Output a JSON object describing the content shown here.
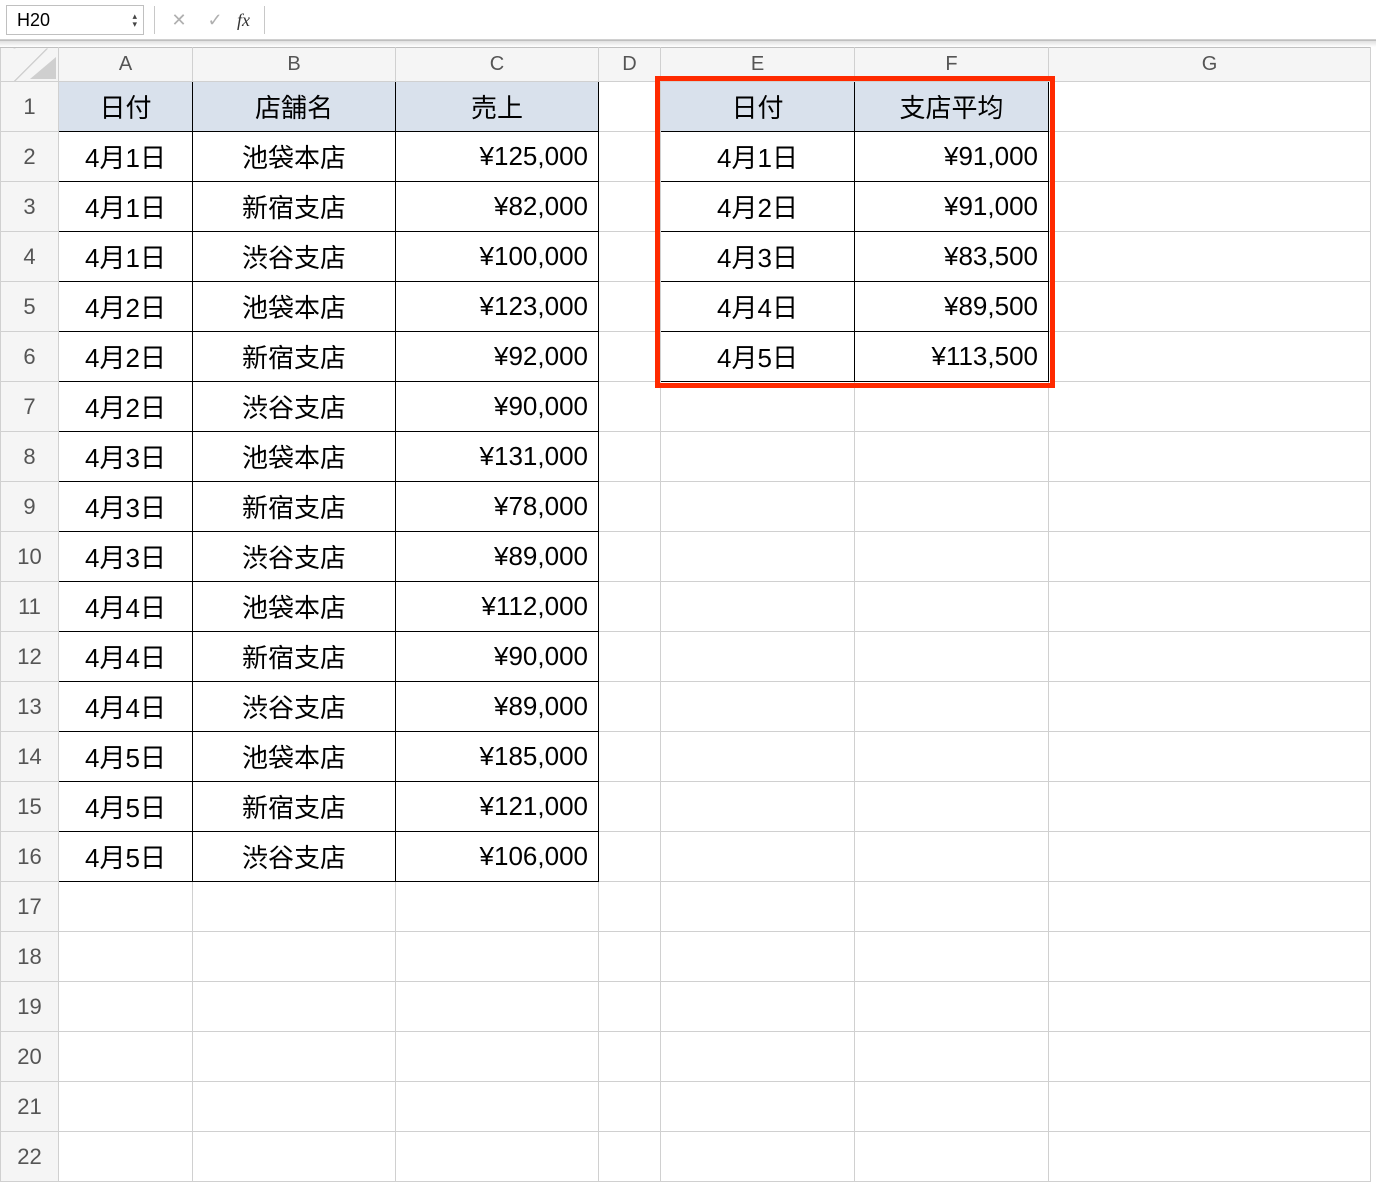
{
  "nameBox": "H20",
  "fx_label": "fx",
  "formula": "",
  "columns": [
    "A",
    "B",
    "C",
    "D",
    "E",
    "F",
    "G"
  ],
  "rowCount": 22,
  "table1": {
    "headers": {
      "A": "日付",
      "B": "店舗名",
      "C": "売上"
    },
    "rows": [
      {
        "date": "4月1日",
        "store": "池袋本店",
        "sales": "¥125,000"
      },
      {
        "date": "4月1日",
        "store": "新宿支店",
        "sales": "¥82,000"
      },
      {
        "date": "4月1日",
        "store": "渋谷支店",
        "sales": "¥100,000"
      },
      {
        "date": "4月2日",
        "store": "池袋本店",
        "sales": "¥123,000"
      },
      {
        "date": "4月2日",
        "store": "新宿支店",
        "sales": "¥92,000"
      },
      {
        "date": "4月2日",
        "store": "渋谷支店",
        "sales": "¥90,000"
      },
      {
        "date": "4月3日",
        "store": "池袋本店",
        "sales": "¥131,000"
      },
      {
        "date": "4月3日",
        "store": "新宿支店",
        "sales": "¥78,000"
      },
      {
        "date": "4月3日",
        "store": "渋谷支店",
        "sales": "¥89,000"
      },
      {
        "date": "4月4日",
        "store": "池袋本店",
        "sales": "¥112,000"
      },
      {
        "date": "4月4日",
        "store": "新宿支店",
        "sales": "¥90,000"
      },
      {
        "date": "4月4日",
        "store": "渋谷支店",
        "sales": "¥89,000"
      },
      {
        "date": "4月5日",
        "store": "池袋本店",
        "sales": "¥185,000"
      },
      {
        "date": "4月5日",
        "store": "新宿支店",
        "sales": "¥121,000"
      },
      {
        "date": "4月5日",
        "store": "渋谷支店",
        "sales": "¥106,000"
      }
    ]
  },
  "table2": {
    "headers": {
      "E": "日付",
      "F": "支店平均"
    },
    "rows": [
      {
        "date": "4月1日",
        "avg": "¥91,000"
      },
      {
        "date": "4月2日",
        "avg": "¥91,000"
      },
      {
        "date": "4月3日",
        "avg": "¥83,500"
      },
      {
        "date": "4月4日",
        "avg": "¥89,500"
      },
      {
        "date": "4月5日",
        "avg": "¥113,500"
      }
    ]
  }
}
